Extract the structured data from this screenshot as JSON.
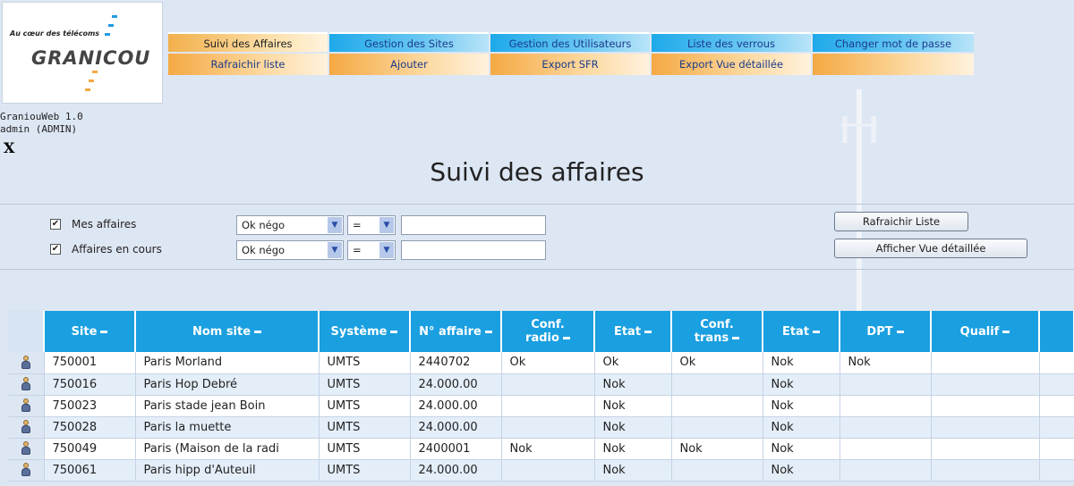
{
  "logo": {
    "slogan": "Au cœur des télécoms",
    "brand": "GRANICOU"
  },
  "meta": {
    "app_version": "GraniouWeb 1.0",
    "user": "admin (ADMIN)",
    "close": "X"
  },
  "menu": {
    "top": [
      {
        "label": "Suivi des Affaires",
        "active": true
      },
      {
        "label": "Gestion des Sites",
        "active": false
      },
      {
        "label": "Gestion des Utilisateurs",
        "active": false
      },
      {
        "label": "Liste des verrous",
        "active": false
      },
      {
        "label": "Changer mot de passe",
        "active": false
      }
    ],
    "sub": [
      "Rafraichir liste",
      "Ajouter",
      "Export SFR",
      "Export Vue détaillée",
      ""
    ]
  },
  "page_title": "Suivi des affaires",
  "filters": {
    "rows": [
      {
        "label": "Mes affaires",
        "checked": true,
        "select1": "Ok négo",
        "select2": "=",
        "text": ""
      },
      {
        "label": "Affaires en cours",
        "checked": true,
        "select1": "Ok négo",
        "select2": "=",
        "text": ""
      }
    ],
    "refresh_button": "Rafraichir Liste",
    "detail_button": "Afficher Vue détaillée"
  },
  "table": {
    "headers": [
      {
        "line1": "Site",
        "line2": ""
      },
      {
        "line1": "Nom site",
        "line2": ""
      },
      {
        "line1": "Système",
        "line2": ""
      },
      {
        "line1": "N° affaire",
        "line2": ""
      },
      {
        "line1": "Conf.",
        "line2": "radio"
      },
      {
        "line1": "Etat",
        "line2": ""
      },
      {
        "line1": "Conf.",
        "line2": "trans"
      },
      {
        "line1": "Etat",
        "line2": ""
      },
      {
        "line1": "DPT",
        "line2": ""
      },
      {
        "line1": "Qualif",
        "line2": ""
      },
      {
        "line1": "",
        "line2": ""
      }
    ],
    "rows": [
      [
        "750001",
        "Paris Morland",
        "UMTS",
        "2440702",
        "Ok",
        "Ok",
        "Ok",
        "Nok",
        "Nok",
        "",
        ""
      ],
      [
        "750016",
        "Paris Hop Debré",
        "UMTS",
        "24.000.00",
        "",
        "Nok",
        "",
        "Nok",
        "",
        "",
        ""
      ],
      [
        "750023",
        "Paris stade jean Boin",
        "UMTS",
        "24.000.00",
        "",
        "Nok",
        "",
        "Nok",
        "",
        "",
        ""
      ],
      [
        "750028",
        "Paris la muette",
        "UMTS",
        "24.000.00",
        "",
        "Nok",
        "",
        "Nok",
        "",
        "",
        ""
      ],
      [
        "750049",
        "Paris (Maison de la radi",
        "UMTS",
        "2400001",
        "Nok",
        "Nok",
        "Nok",
        "Nok",
        "",
        "",
        ""
      ],
      [
        "750061",
        "Paris hipp d'Auteuil",
        "UMTS",
        "24.000.00",
        "",
        "Nok",
        "",
        "Nok",
        "",
        "",
        ""
      ]
    ]
  },
  "icons": {
    "row_icon": "user-icon",
    "sort_icon": "sort-icon",
    "dropdown_icon": "chevron-down-icon"
  },
  "colors": {
    "header_blue": "#1a9fe0",
    "menu_orange": "#f5a943",
    "background": "#dde6f3"
  }
}
